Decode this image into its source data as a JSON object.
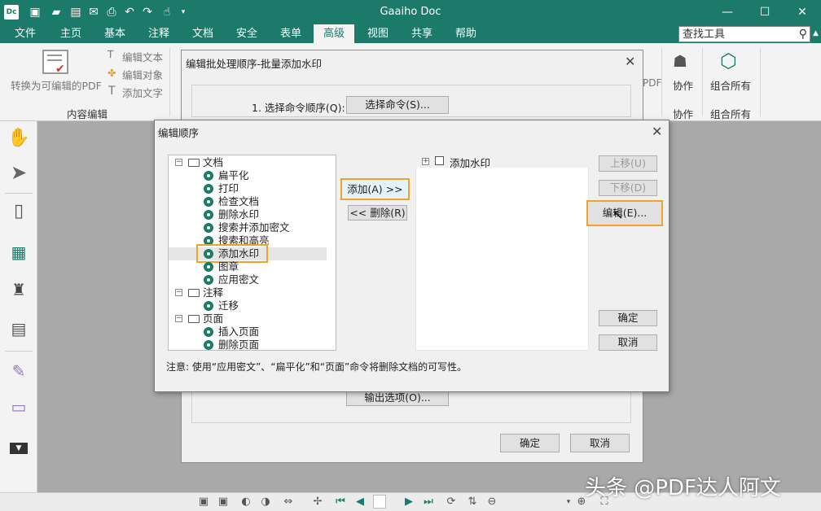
{
  "app": {
    "title": "Gaaiho Doc",
    "logo": "Dc",
    "accent": "#1b7a6a"
  },
  "menu": {
    "items": [
      "文件",
      "主页",
      "基本",
      "注释",
      "文档",
      "安全",
      "表单",
      "高级",
      "视图",
      "共享",
      "帮助"
    ],
    "active": "高级",
    "search_placeholder": "查找工具"
  },
  "ribbon": {
    "convert_label": "转换为可编辑的PDF",
    "edit_text": "编辑文本",
    "edit_object": "编辑对象",
    "add_text": "添加文字",
    "group_content": "内容编辑",
    "collab": "协作",
    "group_collab": "协作",
    "combine": "组合所有",
    "group_combine": "组合所有",
    "pdf_fragment": "PDF"
  },
  "back_dialog": {
    "title": "编辑批处理顺序-批量添加水印",
    "step1_label": "1. 选择命令顺序(Q):",
    "select_cmd_button": "选择命令(S)...",
    "output_button": "输出选项(O)...",
    "ok": "确定",
    "cancel": "取消"
  },
  "front_dialog": {
    "title": "编辑顺序",
    "tree": [
      {
        "label": "文档",
        "type": "folder"
      },
      {
        "label": "扁平化",
        "type": "item"
      },
      {
        "label": "打印",
        "type": "item"
      },
      {
        "label": "检查文档",
        "type": "item"
      },
      {
        "label": "删除水印",
        "type": "item"
      },
      {
        "label": "搜索并添加密文",
        "type": "item"
      },
      {
        "label": "搜索和高亮",
        "type": "item"
      },
      {
        "label": "添加水印",
        "type": "item",
        "selected": true
      },
      {
        "label": "图章",
        "type": "item"
      },
      {
        "label": "应用密文",
        "type": "item"
      },
      {
        "label": "注释",
        "type": "folder"
      },
      {
        "label": "迁移",
        "type": "item"
      },
      {
        "label": "页面",
        "type": "folder"
      },
      {
        "label": "插入页面",
        "type": "item"
      },
      {
        "label": "删除页面",
        "type": "item"
      }
    ],
    "add_button": "添加(A) >>",
    "remove_button": "<< 删除(R)",
    "sequence_item": "添加水印",
    "move_up": "上移(U)",
    "move_down": "下移(D)",
    "edit_button": "编辑(E)...",
    "ok": "确定",
    "cancel": "取消",
    "note": "注意:   使用“应用密文”、“扁平化”和“页面”命令将删除文档的可写性。"
  },
  "watermark_text": "头条 @PDF达人阿文"
}
